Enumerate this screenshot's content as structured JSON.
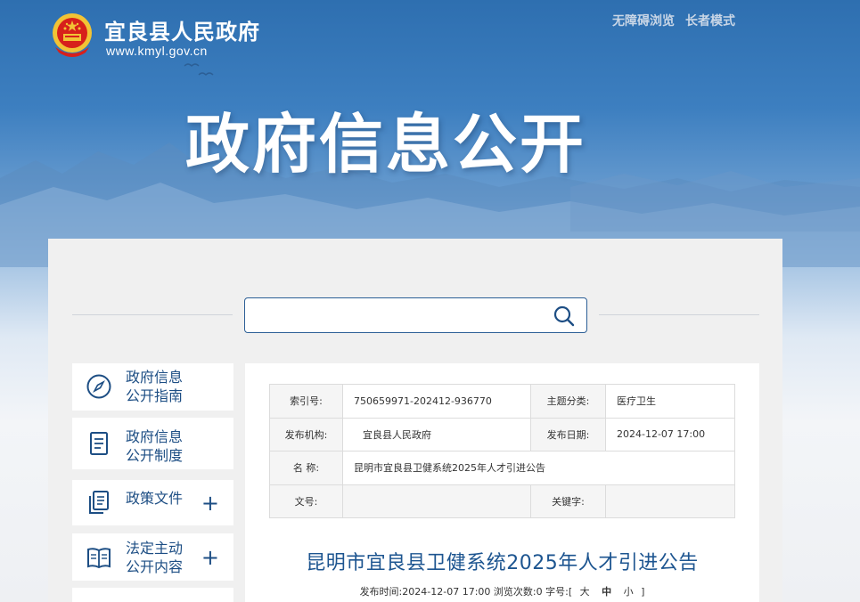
{
  "header": {
    "site_name": "宜良县人民政府",
    "site_url": "www.kmyl.gov.cn",
    "links": [
      "无障碍浏览",
      "长者模式"
    ],
    "banner_title": "政府信息公开"
  },
  "search": {
    "placeholder": ""
  },
  "sidebar": {
    "items": [
      {
        "line1": "政府信息",
        "line2": "公开指南",
        "icon": "compass-icon",
        "expandable": false
      },
      {
        "line1": "政府信息",
        "line2": "公开制度",
        "icon": "document-icon",
        "expandable": false
      },
      {
        "line1": "政策文件",
        "line2": "",
        "icon": "files-icon",
        "expandable": true
      },
      {
        "line1": "法定主动",
        "line2": "公开内容",
        "icon": "book-icon",
        "expandable": true
      }
    ],
    "plus_label": "+"
  },
  "meta": {
    "index_no_label": "索引号:",
    "index_no": "750659971-202412-936770",
    "topic_label": "主题分类:",
    "topic": "医疗卫生",
    "org_label": "发布机构:",
    "org": "宜良县人民政府",
    "date_label": "发布日期:",
    "date": "2024-12-07 17:00",
    "name_label": "名 称:",
    "name": "昆明市宜良县卫健系统2025年人才引进公告",
    "doc_no_label": "文号:",
    "doc_no": "",
    "keywords_label": "关键字:",
    "keywords": ""
  },
  "article": {
    "title": "昆明市宜良县卫健系统2025年人才引进公告",
    "pub_time_label": "发布时间:",
    "pub_time": "2024-12-07 17:00",
    "views_label": "浏览次数:",
    "views": "0",
    "font_label": "字号:",
    "bracket_open": "[",
    "size_large": "大",
    "size_medium": "中",
    "size_small": "小",
    "bracket_close": "]"
  },
  "colors": {
    "accent": "#1d4e84",
    "title_blue": "#1d5590",
    "emblem_red": "#d7201b",
    "emblem_gold": "#f2c335"
  }
}
